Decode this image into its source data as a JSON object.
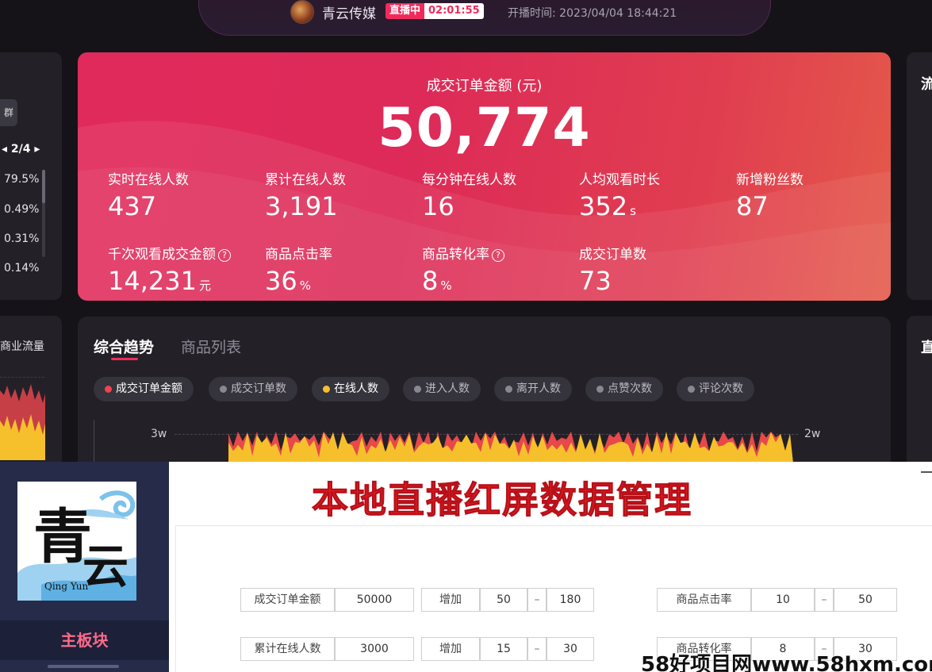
{
  "header": {
    "brand": "青云传媒",
    "live_label": "直播中",
    "live_timer": "02:01:55",
    "start_time": "开播时间: 2023/04/04 18:44:21"
  },
  "left_panel": {
    "button": "群",
    "pager": "◂ 2/4 ▸",
    "percents": [
      "79.5%",
      "0.49%",
      "0.31%",
      "0.14%"
    ],
    "section2_title": "商业流量"
  },
  "right_panel": {
    "title1": "流",
    "title2": "直"
  },
  "hero": {
    "title": "成交订单金额 (元)",
    "value": "50,774",
    "metrics": [
      {
        "label": "实时在线人数",
        "value": "437",
        "unit": ""
      },
      {
        "label": "累计在线人数",
        "value": "3,191",
        "unit": ""
      },
      {
        "label": "每分钟在线人数",
        "value": "16",
        "unit": ""
      },
      {
        "label": "人均观看时长",
        "value": "352",
        "unit": "s"
      },
      {
        "label": "新增粉丝数",
        "value": "87",
        "unit": ""
      },
      {
        "label": "千次观看成交金额",
        "value": "14,231",
        "unit": "元",
        "help": "?"
      },
      {
        "label": "商品点击率",
        "value": "36",
        "unit": "%"
      },
      {
        "label": "商品转化率",
        "value": "8",
        "unit": "%",
        "help": "?"
      },
      {
        "label": "成交订单数",
        "value": "73",
        "unit": ""
      }
    ]
  },
  "trend": {
    "tabs": [
      "综合趋势",
      "商品列表"
    ],
    "chips": [
      {
        "label": "成交订单金额",
        "dot": "#f0444e",
        "on": true
      },
      {
        "label": "成交订单数",
        "dot": "#8a8792",
        "on": false
      },
      {
        "label": "在线人数",
        "dot": "#f6c02c",
        "on": true
      },
      {
        "label": "进入人数",
        "dot": "#8a8792",
        "on": false
      },
      {
        "label": "离开人数",
        "dot": "#8a8792",
        "on": false
      },
      {
        "label": "点赞次数",
        "dot": "#8a8792",
        "on": false
      },
      {
        "label": "评论次数",
        "dot": "#8a8792",
        "on": false
      }
    ],
    "y_left_tick": "3w",
    "y_right_tick": "2w"
  },
  "app": {
    "logo_char1": "青",
    "logo_char2": "云",
    "logo_en": "Qing Yun",
    "menu_active": "主板块",
    "title": "本地直播红屏数据管理",
    "rows": [
      {
        "label": "成交订单金额",
        "value": "50000",
        "op": "增加",
        "min": "50",
        "sep": "–",
        "max": "180",
        "r_label": "商品点击率",
        "r_min": "10",
        "r_sep": "–",
        "r_max": "50"
      },
      {
        "label": "累计在线人数",
        "value": "3000",
        "op": "增加",
        "min": "15",
        "sep": "–",
        "max": "30",
        "r_label": "商品转化率",
        "r_min": "8",
        "r_sep": "–",
        "r_max": "30"
      }
    ]
  },
  "watermark": "58好项目网www.58hxm.com",
  "colors": {
    "accent_pink": "#f02b5b",
    "hero_start": "#e12a5c",
    "hero_end": "#e4594a",
    "title_red": "#ee1c25",
    "sidebar": "#262b4a",
    "series_red": "#e8484a",
    "series_yellow": "#f6c02c"
  }
}
